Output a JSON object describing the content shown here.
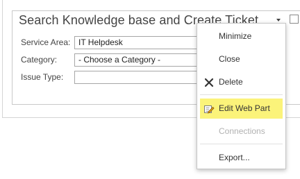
{
  "webpart": {
    "title": "Search Knowledge base and Create Ticket"
  },
  "form": {
    "service_area": {
      "label": "Service Area:",
      "value": "IT Helpdesk"
    },
    "category": {
      "label": "Category:",
      "value": "- Choose a Category -"
    },
    "issue_type": {
      "label": "Issue Type:",
      "value": ""
    }
  },
  "menu": {
    "minimize": "Minimize",
    "close": "Close",
    "delete": "Delete",
    "edit_web_part": "Edit Web Part",
    "connections": "Connections",
    "export": "Export..."
  },
  "colors": {
    "highlight": "#fbf37a",
    "disabled_text": "#b1b1b1"
  },
  "icons": {
    "title_menu": "chevron-down-icon",
    "delete": "x-icon",
    "edit_web_part": "edit-pencil-icon"
  }
}
